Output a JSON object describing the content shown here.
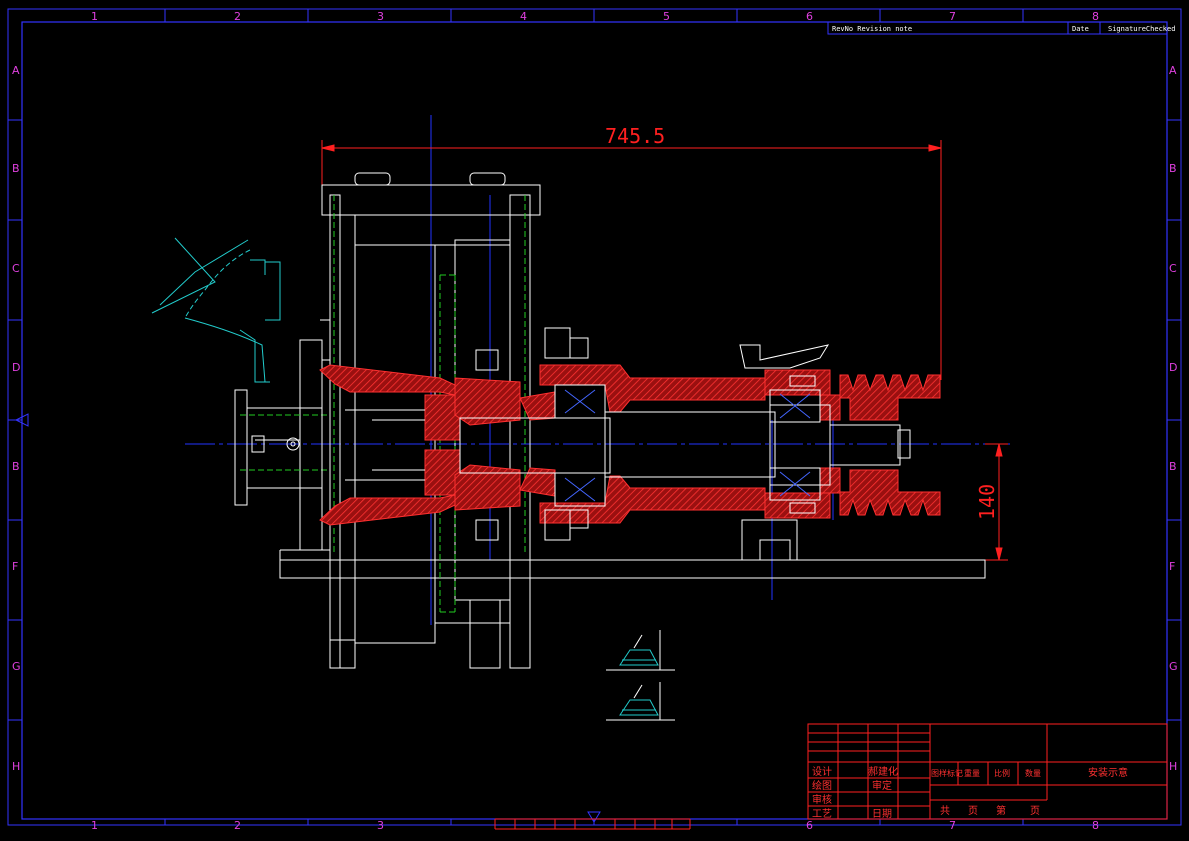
{
  "zones": {
    "columns": [
      "1",
      "2",
      "3",
      "4",
      "5",
      "6",
      "7",
      "8"
    ],
    "rows": [
      "A",
      "B",
      "C",
      "D",
      "E",
      "F",
      "G",
      "H"
    ]
  },
  "revision_block": {
    "label": "RevNo Revision note",
    "date": "Date",
    "signature": "SignatureChecked"
  },
  "dimensions": {
    "overall_length": "745.5",
    "shaft_height": "140"
  },
  "title_block": {
    "design_label": "设计",
    "designer_name": "郝建化",
    "drawing_label": "绘图",
    "approval_label": "审定",
    "review_label": "审核",
    "process_label": "工艺",
    "date_label": "日期",
    "stage_mark": "图样标记",
    "weight": "重量",
    "ratio": "比例",
    "quantity": "数量",
    "total": "共",
    "sheet_unit_1": "页",
    "sheet_label": "第",
    "sheet_unit_2": "页",
    "drawing_title": "安装示意"
  },
  "colors": {
    "frame": "#3333ff",
    "title_block": "#ff2020",
    "section_fill": "#dd1111",
    "outline": "#ffffff",
    "centerline": "#2233ff",
    "hidden": "#22cc22",
    "aux": "#22cccc"
  }
}
